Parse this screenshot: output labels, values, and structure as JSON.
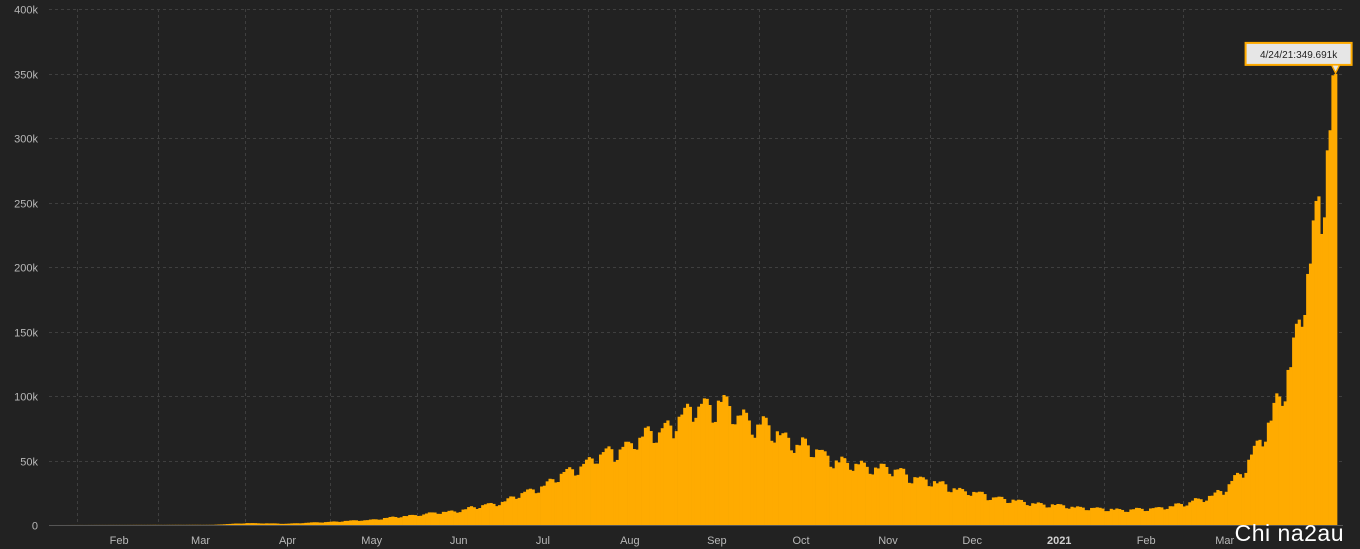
{
  "watermark": "Chi na2au",
  "chart_data": {
    "type": "bar",
    "title": "",
    "xlabel": "",
    "ylabel": "",
    "x_start": "2020-01-22",
    "x_end": "2021-04-24",
    "x_ticks": [
      {
        "date": "2020-02-01",
        "label": "Feb",
        "bold": false
      },
      {
        "date": "2020-03-01",
        "label": "Mar",
        "bold": false
      },
      {
        "date": "2020-04-01",
        "label": "Apr",
        "bold": false
      },
      {
        "date": "2020-05-01",
        "label": "May",
        "bold": false
      },
      {
        "date": "2020-06-01",
        "label": "Jun",
        "bold": false
      },
      {
        "date": "2020-07-01",
        "label": "Jul",
        "bold": false
      },
      {
        "date": "2020-08-01",
        "label": "Aug",
        "bold": false
      },
      {
        "date": "2020-09-01",
        "label": "Sep",
        "bold": false
      },
      {
        "date": "2020-10-01",
        "label": "Oct",
        "bold": false
      },
      {
        "date": "2020-11-01",
        "label": "Nov",
        "bold": false
      },
      {
        "date": "2020-12-01",
        "label": "Dec",
        "bold": false
      },
      {
        "date": "2021-01-01",
        "label": "2021",
        "bold": true
      },
      {
        "date": "2021-02-01",
        "label": "Feb",
        "bold": false
      },
      {
        "date": "2021-03-01",
        "label": "Mar",
        "bold": false
      }
    ],
    "ylim": [
      0,
      400000
    ],
    "y_ticks": [
      {
        "value": 0,
        "label": "0"
      },
      {
        "value": 50000,
        "label": "50k"
      },
      {
        "value": 100000,
        "label": "100k"
      },
      {
        "value": 150000,
        "label": "150k"
      },
      {
        "value": 200000,
        "label": "200k"
      },
      {
        "value": 250000,
        "label": "250k"
      },
      {
        "value": 300000,
        "label": "300k"
      },
      {
        "value": 350000,
        "label": "350k"
      },
      {
        "value": 400000,
        "label": "400k"
      }
    ],
    "grid": true,
    "bar_color": "#ffab00",
    "background": "#222222",
    "series_anchors": [
      [
        "2020-01-22",
        0
      ],
      [
        "2020-03-01",
        100
      ],
      [
        "2020-03-20",
        150
      ],
      [
        "2020-04-01",
        1500
      ],
      [
        "2020-04-15",
        1000
      ],
      [
        "2020-05-01",
        2500
      ],
      [
        "2020-05-15",
        4000
      ],
      [
        "2020-06-01",
        8000
      ],
      [
        "2020-06-15",
        11000
      ],
      [
        "2020-07-01",
        18000
      ],
      [
        "2020-07-15",
        30000
      ],
      [
        "2020-08-01",
        50000
      ],
      [
        "2020-08-15",
        62000
      ],
      [
        "2020-09-01",
        80000
      ],
      [
        "2020-09-10",
        94000
      ],
      [
        "2020-09-17",
        93000
      ],
      [
        "2020-10-01",
        77000
      ],
      [
        "2020-10-15",
        63000
      ],
      [
        "2020-11-01",
        47000
      ],
      [
        "2020-11-15",
        44000
      ],
      [
        "2020-12-01",
        33000
      ],
      [
        "2020-12-15",
        25000
      ],
      [
        "2021-01-01",
        18000
      ],
      [
        "2021-01-15",
        15000
      ],
      [
        "2021-02-01",
        12000
      ],
      [
        "2021-02-15",
        12000
      ],
      [
        "2021-03-01",
        16000
      ],
      [
        "2021-03-15",
        26000
      ],
      [
        "2021-03-22",
        43000
      ],
      [
        "2021-04-01",
        80000
      ],
      [
        "2021-04-08",
        126000
      ],
      [
        "2021-04-15",
        200000
      ],
      [
        "2021-04-20",
        275000
      ],
      [
        "2021-04-24",
        349691
      ]
    ],
    "tooltip": {
      "date": "2021-04-24",
      "value": 349691,
      "text": "4/24/21:349.691k"
    }
  }
}
